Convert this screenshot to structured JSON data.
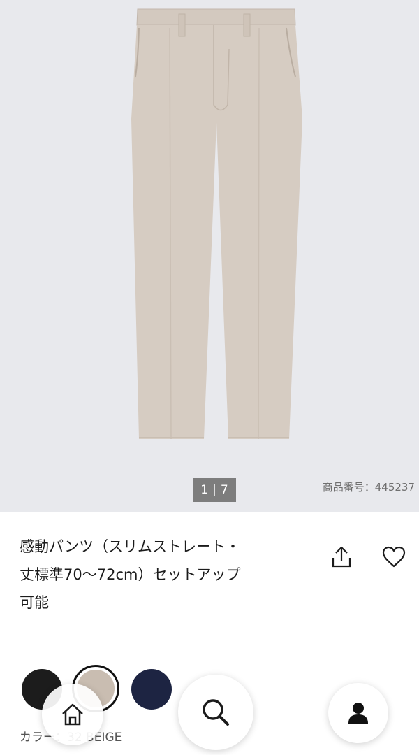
{
  "gallery": {
    "pager_current": "1",
    "pager_separator": "|",
    "pager_total": "7",
    "sku_text": "商品番号：445237"
  },
  "product": {
    "title_lines": [
      "感動パンツ（スリムストレート・",
      "丈標準70〜72cm）セットアップ",
      "可能"
    ]
  },
  "colors": {
    "label": "カラー：32 BEIGE",
    "swatches": [
      {
        "name": "black",
        "hex": "#1c1c1c"
      },
      {
        "name": "beige",
        "hex": "#c9bdb1",
        "selected": true
      },
      {
        "name": "navy",
        "hex": "#1d2442"
      }
    ]
  },
  "icons": {
    "share": "share-icon",
    "favorite": "heart-icon",
    "home": "home-icon",
    "search": "search-icon",
    "account": "account-icon"
  },
  "theme": {
    "gallery_bg": "#e8e9ed",
    "pants_color": "#d6ccc2"
  }
}
